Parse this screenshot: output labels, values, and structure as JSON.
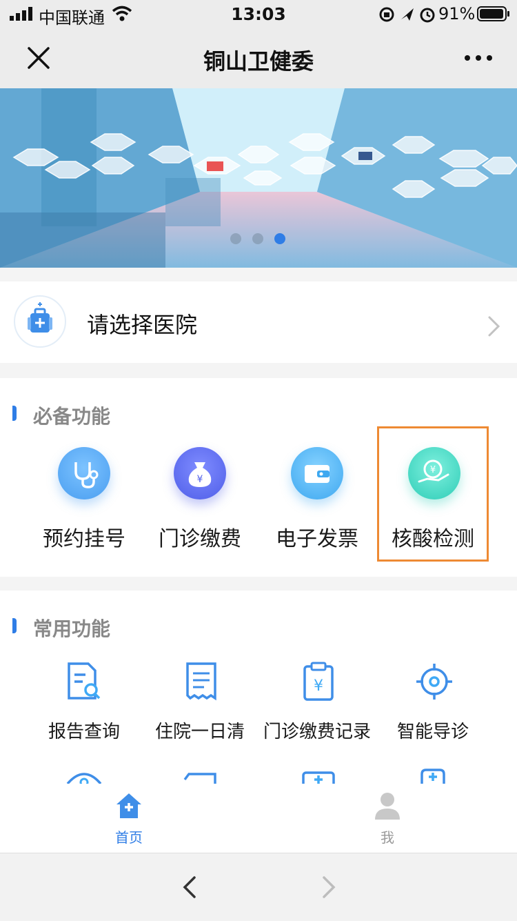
{
  "status_bar": {
    "carrier": "中国联通",
    "time": "13:03",
    "battery": "91%"
  },
  "nav": {
    "title": "铜山卫健委"
  },
  "banner": {
    "slide_count": 3,
    "active_slide": 3
  },
  "hospital_select": {
    "label": "请选择医院"
  },
  "essential": {
    "title": "必备功能",
    "items": [
      {
        "label": "预约挂号",
        "icon": "stethoscope-icon",
        "color": "#4fa3f2"
      },
      {
        "label": "门诊缴费",
        "icon": "money-bag-icon",
        "color": "#5a6ef0"
      },
      {
        "label": "电子发票",
        "icon": "wallet-icon",
        "color": "#48b0f0"
      },
      {
        "label": "核酸检测",
        "icon": "hand-coin-icon",
        "color": "#3fd3c0"
      }
    ]
  },
  "common": {
    "title": "常用功能",
    "items": [
      {
        "label": "报告查询",
        "icon": "report-search-icon"
      },
      {
        "label": "住院一日清",
        "icon": "receipt-icon"
      },
      {
        "label": "门诊缴费记录",
        "icon": "payment-record-icon"
      },
      {
        "label": "智能导诊",
        "icon": "target-icon"
      }
    ]
  },
  "tabbar": {
    "home": "首页",
    "me": "我"
  },
  "colors": {
    "accent": "#2f7de6",
    "highlight": "#ee8a33"
  }
}
